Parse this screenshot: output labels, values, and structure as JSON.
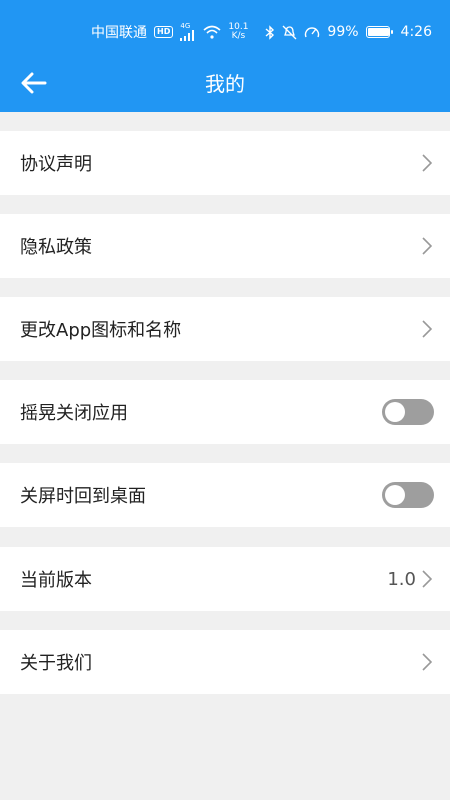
{
  "status_bar": {
    "carrier": "中国联通",
    "hd_badge": "HD",
    "network": "4G",
    "speed_value": "10.1",
    "speed_unit": "K/s",
    "battery_percent": "99%",
    "battery_level": 0.99,
    "time": "4:26",
    "icons": [
      "wifi-icon",
      "bluetooth-icon",
      "mute-icon",
      "speedometer-icon",
      "battery-icon"
    ]
  },
  "header": {
    "title": "我的",
    "back_icon": "back-arrow-icon",
    "color": "#2196f3"
  },
  "settings": [
    {
      "label": "协议声明",
      "type": "link"
    },
    {
      "label": "隐私政策",
      "type": "link"
    },
    {
      "label": "更改App图标和名称",
      "type": "link"
    },
    {
      "label": "摇晃关闭应用",
      "type": "toggle",
      "on": false
    },
    {
      "label": "关屏时回到桌面",
      "type": "toggle",
      "on": false
    },
    {
      "label": "当前版本",
      "type": "value",
      "value": "1.0"
    },
    {
      "label": "关于我们",
      "type": "link"
    }
  ]
}
